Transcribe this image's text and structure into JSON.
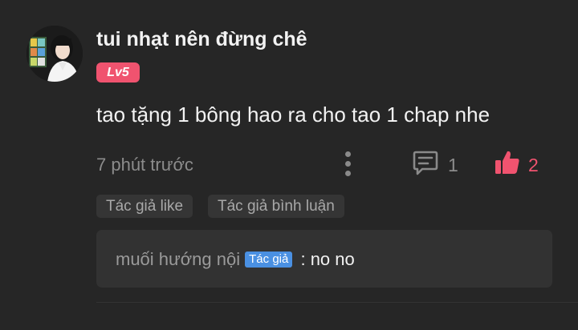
{
  "comment": {
    "username": "tui nhạt nên đừng chê",
    "level": "Lv5",
    "content": "tao tặng 1 bông hao ra cho tao 1 chap nhe",
    "timestamp": "7 phút trước",
    "reply_count": "1",
    "like_count": "2",
    "liked": true,
    "tags": [
      "Tác giả like",
      "Tác giả bình luận"
    ],
    "icons": {
      "avatar": "user-photo-avatar",
      "more": "more-vertical-icon",
      "reply": "comment-bubble-icon",
      "like": "thumbs-up-icon"
    }
  },
  "reply": {
    "author": "muối hướng nội",
    "author_badge": "Tác giả",
    "separator": " : ",
    "text": "no no"
  },
  "colors": {
    "background": "#262626",
    "accent_pink": "#f0536f",
    "author_badge_blue": "#4a90e2",
    "text_primary": "#f2f2f2",
    "text_secondary": "#8c8c8c"
  }
}
